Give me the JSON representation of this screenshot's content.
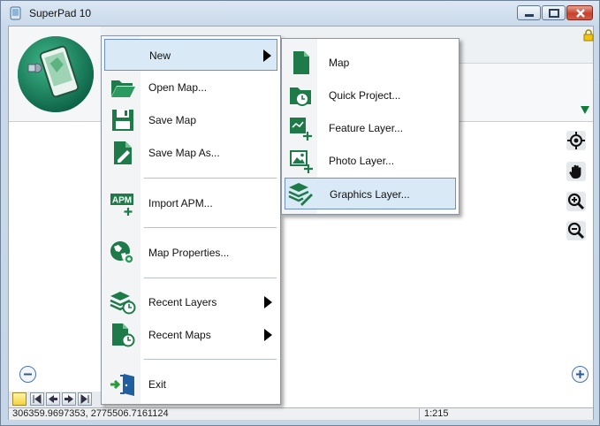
{
  "window": {
    "title": "SuperPad 10"
  },
  "main_menu": {
    "items": [
      {
        "label": "New",
        "icon": "new-icon",
        "submenu": true,
        "highlighted": true
      },
      {
        "label": "Open Map...",
        "icon": "folder-open-icon"
      },
      {
        "label": "Save Map",
        "icon": "save-icon"
      },
      {
        "label": "Save Map As...",
        "icon": "save-as-icon"
      },
      {
        "label": "Import APM...",
        "icon": "apm-import-icon",
        "icon_text": "APM"
      },
      {
        "label": "Map Properties...",
        "icon": "globe-gear-icon"
      },
      {
        "label": "Recent Layers",
        "icon": "recent-layers-icon",
        "submenu": true
      },
      {
        "label": "Recent Maps",
        "icon": "recent-maps-icon",
        "submenu": true
      },
      {
        "label": "Exit",
        "icon": "exit-icon"
      }
    ]
  },
  "new_submenu": {
    "items": [
      {
        "label": "Map",
        "icon": "map-document-icon"
      },
      {
        "label": "Quick Project...",
        "icon": "quick-project-icon"
      },
      {
        "label": "Feature Layer...",
        "icon": "feature-layer-icon"
      },
      {
        "label": "Photo Layer...",
        "icon": "photo-layer-icon"
      },
      {
        "label": "Graphics Layer...",
        "icon": "graphics-layer-icon",
        "highlighted": true
      }
    ]
  },
  "status_bar": {
    "coordinates": "306359.9697353, 2775506.7161124",
    "scale": "1:215"
  },
  "colors": {
    "icon_green": "#1f7a4a",
    "highlight_bg": "#d9eaf6",
    "highlight_border": "#6e8fc4",
    "close_red": "#c7412c"
  }
}
